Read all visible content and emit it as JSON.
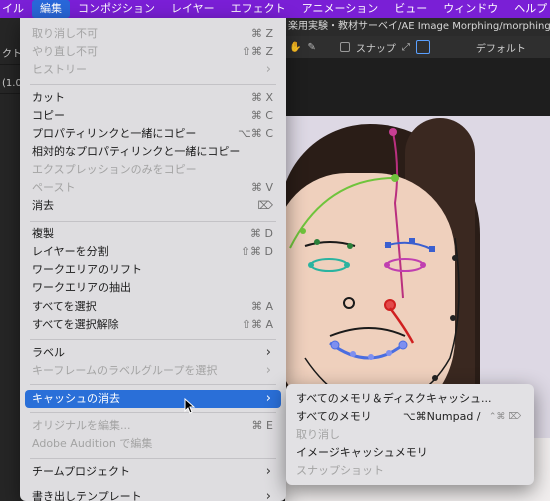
{
  "menubar": {
    "items": [
      {
        "label": "イル",
        "active": false
      },
      {
        "label": "編集",
        "active": true
      },
      {
        "label": "コンポジション",
        "active": false
      },
      {
        "label": "レイヤー",
        "active": false
      },
      {
        "label": "エフェクト",
        "active": false
      },
      {
        "label": "アニメーション",
        "active": false
      },
      {
        "label": "ビュー",
        "active": false
      },
      {
        "label": "ウィンドウ",
        "active": false
      },
      {
        "label": "ヘルプ",
        "active": false
      }
    ]
  },
  "app": {
    "title_path": "楽用実験・教材サーベイ/AE Image Morphing/morphing_project/",
    "toolbar": {
      "snap_label": "スナップ",
      "default_label": "デフォルト"
    },
    "left_rows": [
      "クト",
      "(1.0",
      "",
      "",
      ""
    ]
  },
  "edit_menu": {
    "items": [
      {
        "label": "取り消し不可",
        "shortcut": "⌘ Z",
        "disabled": true
      },
      {
        "label": "やり直し不可",
        "shortcut": "⇧⌘ Z",
        "disabled": true
      },
      {
        "label": "ヒストリー",
        "arrow": "›",
        "disabled": true
      },
      {
        "label": "カット",
        "shortcut": "⌘ X",
        "disabled": false
      },
      {
        "label": "コピー",
        "shortcut": "⌘ C",
        "disabled": false
      },
      {
        "label": "プロパティリンクと一緒にコピー",
        "shortcut": "⌥⌘ C",
        "disabled": false
      },
      {
        "label": "相対的なプロパティリンクと一緒にコピー",
        "disabled": false
      },
      {
        "label": "エクスプレッションのみをコピー",
        "disabled": true
      },
      {
        "label": "ペースト",
        "shortcut": "⌘ V",
        "disabled": true
      },
      {
        "label": "消去",
        "shortcut": "⌦",
        "disabled": false
      },
      {
        "label": "複製",
        "shortcut": "⌘ D",
        "disabled": false
      },
      {
        "label": "レイヤーを分割",
        "shortcut": "⇧⌘ D",
        "disabled": false
      },
      {
        "label": "ワークエリアのリフト",
        "disabled": false
      },
      {
        "label": "ワークエリアの抽出",
        "disabled": false
      },
      {
        "label": "すべてを選択",
        "shortcut": "⌘ A",
        "disabled": false
      },
      {
        "label": "すべてを選択解除",
        "shortcut": "⇧⌘ A",
        "disabled": false
      },
      {
        "label": "ラベル",
        "arrow": "›",
        "disabled": false
      },
      {
        "label": "キーフレームのラベルグループを選択",
        "arrow": "›",
        "disabled": true
      },
      {
        "label": "キャッシュの消去",
        "arrow": "›",
        "disabled": false,
        "highlighted": true
      },
      {
        "label": "オリジナルを編集...",
        "shortcut": "⌘ E",
        "disabled": true
      },
      {
        "label": "Adobe Audition で編集",
        "disabled": true
      },
      {
        "label": "チームプロジェクト",
        "arrow": "›",
        "disabled": false
      },
      {
        "label": "書き出しテンプレート",
        "arrow": "›",
        "disabled": false
      }
    ]
  },
  "sub_menu": {
    "items": [
      {
        "label": "すべてのメモリ＆ディスクキャッシュ...",
        "disabled": false
      },
      {
        "label": "すべてのメモリ",
        "shortcut": "⌥⌘Numpad /",
        "shortcut2": "⌃⌘ ⌦",
        "disabled": false
      },
      {
        "label": "取り消し",
        "disabled": true
      },
      {
        "label": "イメージキャッシュメモリ",
        "disabled": false
      },
      {
        "label": "スナップショット",
        "disabled": true
      }
    ]
  },
  "colors": {
    "menubar_bg": "#7a1fd6",
    "highlight": "#2a6fd8",
    "menu_bg": "#dedde0"
  }
}
